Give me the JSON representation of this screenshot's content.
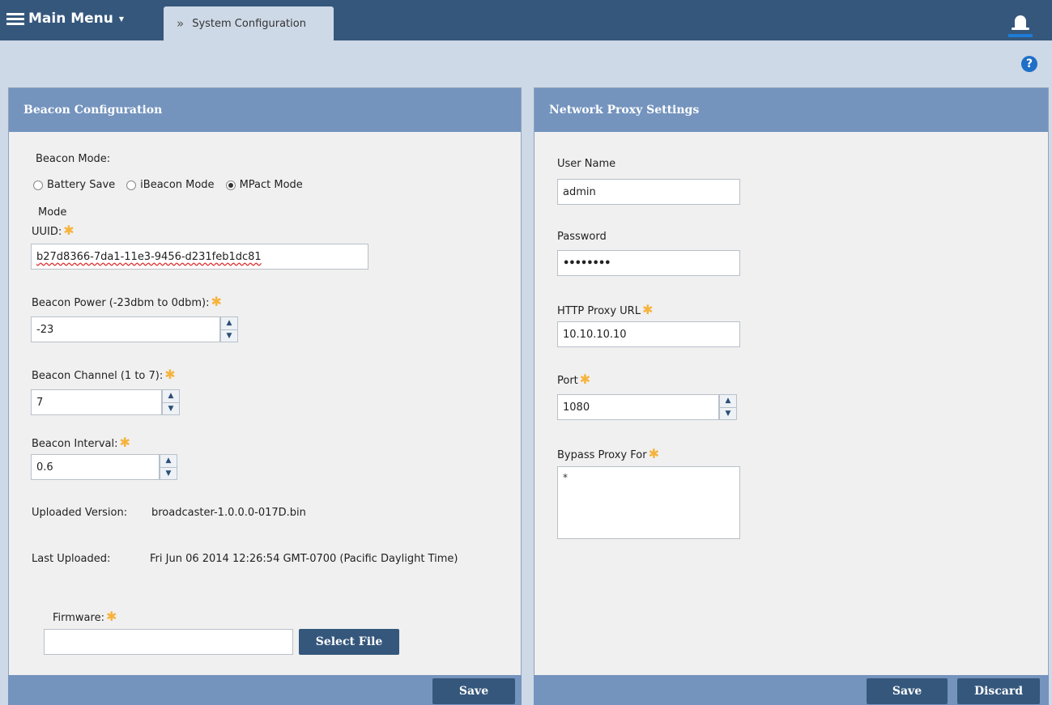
{
  "topbar": {
    "main_menu_label": "Main Menu",
    "tab_label": "System Configuration"
  },
  "beacon": {
    "header": "Beacon Configuration",
    "mode_label": "Beacon Mode:",
    "mode_options": [
      "Battery Save",
      "iBeacon Mode",
      "MPact Mode"
    ],
    "mode_selected": "MPact Mode",
    "mode_word": "Mode",
    "uuid_label": "UUID:",
    "uuid_value": "b27d8366-7da1-11e3-9456-d231feb1dc81",
    "power_label": "Beacon Power (-23dbm to 0dbm):",
    "power_value": "-23",
    "channel_label": "Beacon Channel (1 to 7):",
    "channel_value": "7",
    "interval_label": "Beacon Interval:",
    "interval_value": "0.6",
    "uploaded_version_label": "Uploaded Version:",
    "uploaded_version_value": "broadcaster-1.0.0.0-017D.bin",
    "last_uploaded_label": "Last Uploaded:",
    "last_uploaded_value": "Fri Jun 06 2014 12:26:54 GMT-0700 (Pacific Daylight Time)",
    "firmware_label": "Firmware:",
    "firmware_value": "",
    "select_file_label": "Select File",
    "save_label": "Save"
  },
  "proxy": {
    "header": "Network Proxy Settings",
    "username_label": "User Name",
    "username_value": "admin",
    "password_label": "Password",
    "password_value": "••••••••",
    "http_url_label": "HTTP Proxy URL",
    "http_url_value": "10.10.10.10",
    "port_label": "Port",
    "port_value": "1080",
    "bypass_label": "Bypass Proxy For",
    "bypass_value": "*",
    "save_label": "Save",
    "discard_label": "Discard"
  },
  "required_mark": "✱",
  "colors": {
    "topbar": "#35577c",
    "panel_header": "#7494be",
    "required": "#f6b33c",
    "help": "#1f6fc7"
  },
  "icons": [
    "hamburger-icon",
    "chevron-double-right-icon",
    "bell-icon",
    "help-icon",
    "spinner-up-icon",
    "spinner-down-icon"
  ]
}
